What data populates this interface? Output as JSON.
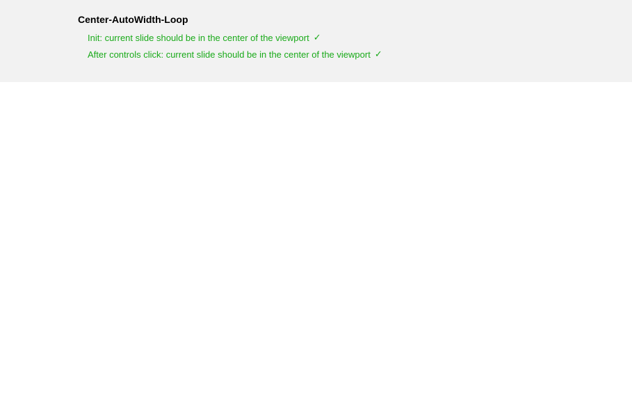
{
  "suite": {
    "title": "Center-AutoWidth-Loop",
    "tests": [
      {
        "label": "Init: current slide should be in the center of the viewport",
        "status_icon": "✓"
      },
      {
        "label": "After controls click: current slide should be in the center of the viewport",
        "status_icon": "✓"
      }
    ]
  }
}
